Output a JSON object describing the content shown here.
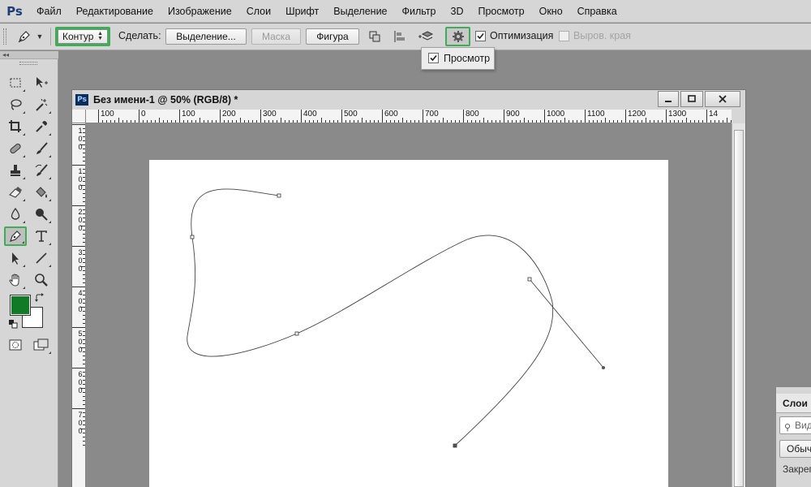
{
  "app": {
    "logo": "Ps"
  },
  "menu": [
    "Файл",
    "Редактирование",
    "Изображение",
    "Слои",
    "Шрифт",
    "Выделение",
    "Фильтр",
    "3D",
    "Просмотр",
    "Окно",
    "Справка"
  ],
  "options": {
    "mode_value": "Контур",
    "make_label": "Сделать:",
    "selection_btn": "Выделение...",
    "mask_btn": "Маска",
    "shape_btn": "Фигура",
    "optimize_label": "Оптимизация",
    "align_edges_label": "Выров. края"
  },
  "popup": {
    "preview_label": "Просмотр"
  },
  "document": {
    "title": "Без имени-1 @ 50% (RGB/8) *"
  },
  "ruler_h": [
    "100",
    "0",
    "100",
    "200",
    "300",
    "400",
    "500",
    "600",
    "700",
    "800",
    "900",
    "1000",
    "1100",
    "1200",
    "1300",
    "14"
  ],
  "ruler_v": [
    "1",
    "0",
    "0",
    "1",
    "0",
    "0",
    "2",
    "0",
    "0",
    "3",
    "0",
    "0",
    "4",
    "0",
    "0",
    "5",
    "0",
    "0",
    "6",
    "0",
    "0",
    "7",
    "0",
    "0"
  ],
  "layers": {
    "tab": "Слои",
    "search_placeholder": "Вид",
    "blend_mode": "Обыч",
    "lock_label": "Закреп"
  },
  "colors": {
    "foreground": "#107a26",
    "background": "#ffffff",
    "highlight": "#3dae55"
  }
}
